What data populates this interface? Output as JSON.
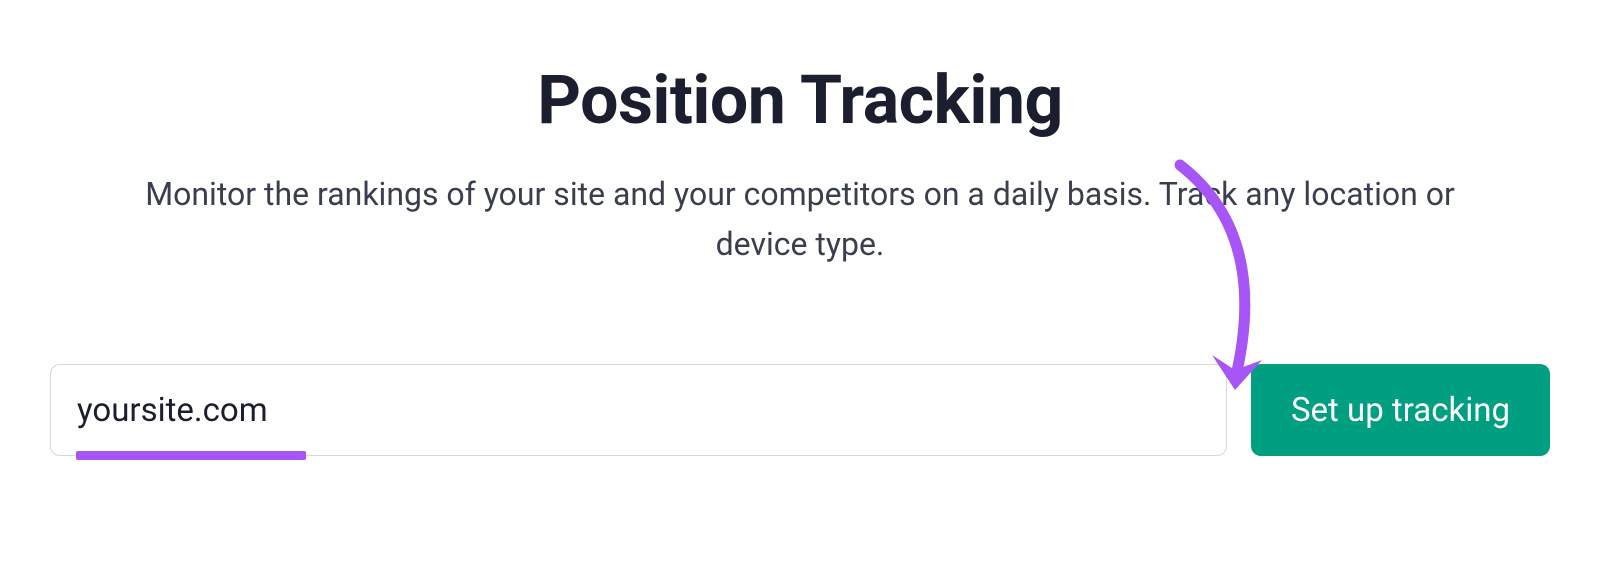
{
  "header": {
    "title": "Position Tracking",
    "subtitle": "Monitor the rankings of your site and your competitors on a daily basis. Track any location or device type."
  },
  "form": {
    "domain_value": "yoursite.com",
    "cta_label": "Set up tracking"
  },
  "colors": {
    "accent_purple": "#a855f7",
    "cta_green": "#009f81",
    "text_dark": "#1a1e2e"
  }
}
